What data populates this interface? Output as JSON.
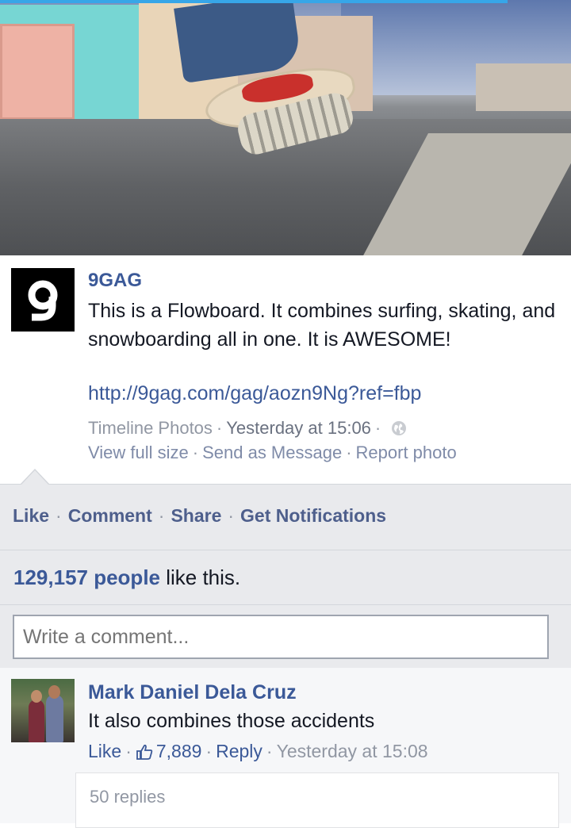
{
  "post": {
    "author": "9GAG",
    "message": "This is a Flowboard. It combines surfing, skating, and snowboarding all in one. It is AWESOME!",
    "link": "http://9gag.com/gag/aozn9Ng?ref=fbp",
    "album": "Timeline Photos",
    "time": "Yesterday at 15:06",
    "view_full_size": "View full size",
    "send_as_message": "Send as Message",
    "report_photo": "Report photo",
    "logo_text": "9"
  },
  "actions": {
    "like": "Like",
    "comment": "Comment",
    "share": "Share",
    "notifications": "Get Notifications"
  },
  "likes": {
    "count": "129,157 people",
    "suffix": " like this."
  },
  "write_comment": {
    "placeholder": "Write a comment..."
  },
  "comment": {
    "author": "Mark Daniel Dela Cruz",
    "text": "It also combines those accidents",
    "like": "Like",
    "like_count": "7,889",
    "reply": "Reply",
    "time": "Yesterday at 15:08",
    "replies": "50 replies"
  },
  "colors": {
    "link": "#3b5998",
    "bar": "#e9eaed"
  }
}
